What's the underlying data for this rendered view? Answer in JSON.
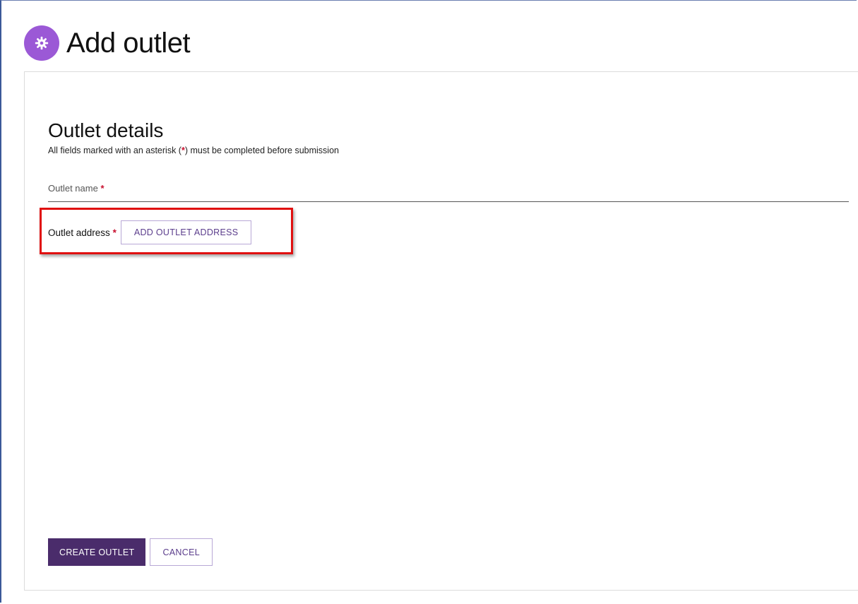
{
  "header": {
    "icon": "gear-icon",
    "title": "Add outlet"
  },
  "form": {
    "section_title": "Outlet details",
    "help_prefix": "All fields marked with an asterisk (",
    "help_asterisk": "*",
    "help_suffix": ") must be completed before submission",
    "outlet_name": {
      "label": "Outlet name",
      "required_marker": "*",
      "value": ""
    },
    "outlet_address": {
      "label": "Outlet address",
      "required_marker": "*",
      "button_label": "ADD OUTLET ADDRESS"
    }
  },
  "actions": {
    "create_label": "CREATE OUTLET",
    "cancel_label": "CANCEL"
  },
  "colors": {
    "accent": "#9b59d6",
    "primary_button": "#4a2c6b",
    "required": "#c8102e",
    "highlight": "#e01010"
  }
}
